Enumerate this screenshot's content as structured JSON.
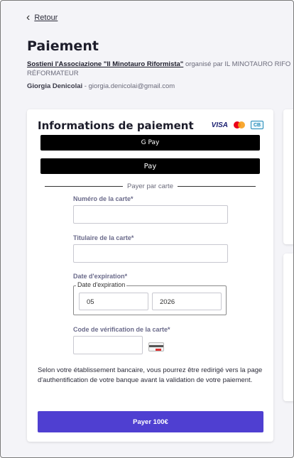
{
  "nav": {
    "back_label": "Retour"
  },
  "page": {
    "title": "Paiement"
  },
  "campaign": {
    "name": "Sostieni l'Associazione \"Il Minotauro Riformista\"",
    "organized_text": "organisé par IL MINOTAURO RIFO",
    "organizer_cont": "RÉFORMATEUR"
  },
  "user": {
    "name": "Giorgia Denicolai",
    "email": " - giorgia.denicolai@gmail.com"
  },
  "payment": {
    "title": "Informations de paiement",
    "brands": {
      "visa": "VISA",
      "cb": "CB",
      "mastercard_colors": [
        "#eb001b",
        "#f79e1b"
      ]
    },
    "gpay_label": "G Pay",
    "apay_label": " Pay",
    "divider_text": "Payer par carte",
    "card_number_label": "Numéro de la carte*",
    "card_number_value": "",
    "holder_label": "Titulaire de la carte*",
    "holder_value": "",
    "expiry_label": "Date d'expiration*",
    "expiry_legend": "Date d'expiration",
    "expiry_month": "05",
    "expiry_year": "2026",
    "cvv_label": "Code de vérification de la carte*",
    "cvv_value": "",
    "info_text": "Selon votre établissement bancaire, vous pourrez être redirigé vers la page d'authentification de votre banque avant la validation de votre paiement.",
    "submit_label": "Payer 100€",
    "accent_color": "#4f3fd1"
  }
}
